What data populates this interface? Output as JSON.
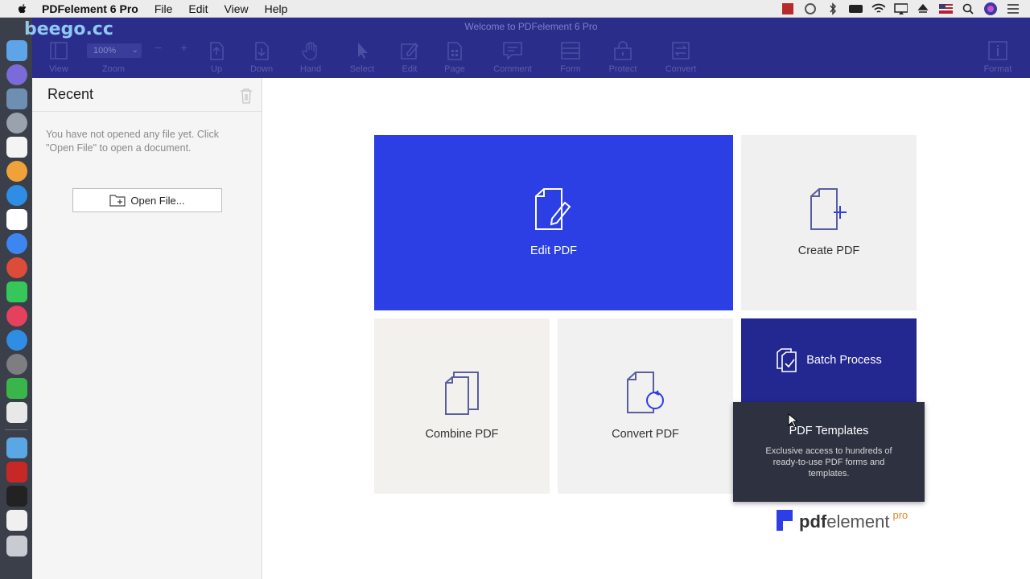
{
  "menubar": {
    "app_name": "PDFelement 6 Pro",
    "items": [
      "File",
      "Edit",
      "View",
      "Help"
    ],
    "status_icons": [
      "app-icon",
      "network-icon",
      "bluetooth-icon",
      "battery-icon",
      "wifi-icon",
      "airplay-icon",
      "eject-icon",
      "flag-icon",
      "spotlight-icon",
      "siri-icon",
      "notification-icon"
    ]
  },
  "watermark": "beego.cc",
  "window": {
    "title": "Welcome to PDFelement 6 Pro",
    "toolbar": {
      "zoom_value": "100%",
      "items": [
        {
          "label": "View",
          "icon": "view-icon"
        },
        {
          "label": "Zoom",
          "icon": "zoom-icon"
        },
        {
          "label": "Up",
          "icon": "up-icon"
        },
        {
          "label": "Down",
          "icon": "down-icon"
        },
        {
          "label": "Hand",
          "icon": "hand-icon"
        },
        {
          "label": "Select",
          "icon": "select-icon"
        },
        {
          "label": "Edit",
          "icon": "edit-icon"
        },
        {
          "label": "Page",
          "icon": "page-icon"
        },
        {
          "label": "Comment",
          "icon": "comment-icon"
        },
        {
          "label": "Form",
          "icon": "form-icon"
        },
        {
          "label": "Protect",
          "icon": "protect-icon"
        },
        {
          "label": "Convert",
          "icon": "convert-icon"
        },
        {
          "label": "Format",
          "icon": "format-icon"
        }
      ]
    }
  },
  "recent": {
    "title": "Recent",
    "empty_message": "You have not opened any file yet. Click \"Open File\" to open a document.",
    "open_button": "Open File..."
  },
  "tiles": {
    "edit": "Edit PDF",
    "create": "Create PDF",
    "combine": "Combine PDF",
    "convert": "Convert PDF",
    "batch": "Batch Process"
  },
  "tooltip": {
    "title": "PDF Templates",
    "description": "Exclusive access to hundreds of ready-to-use PDF forms and templates."
  },
  "brand": {
    "pdf": "pdf",
    "element": "element",
    "pro": "pro"
  },
  "colors": {
    "toolbar": "#2a2d8a",
    "edit_tile": "#2b3fe5",
    "batch_tile": "#22288f",
    "pro_accent": "#e08a2c"
  }
}
